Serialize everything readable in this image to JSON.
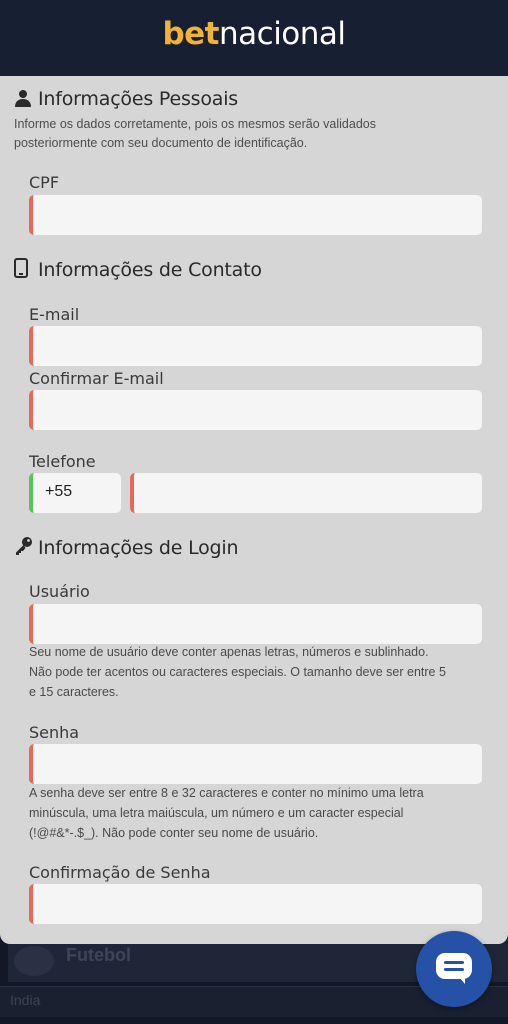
{
  "header": {
    "logo_bet": "bet",
    "logo_rest": "nacional"
  },
  "personal": {
    "title": "Informações Pessoais",
    "description_line1": "Informe os dados corretamente, pois os mesmos serão validados",
    "description_line2": "posteriormente com seu documento de identificação.",
    "cpf_label": "CPF",
    "cpf_value": ""
  },
  "contact": {
    "title": "Informações de Contato",
    "email_label": "E-mail",
    "email_value": "",
    "confirm_email_label": "Confirmar E-mail",
    "confirm_email_value": "",
    "phone_label": "Telefone",
    "country_code": "+55",
    "phone_value": ""
  },
  "login": {
    "title": "Informações de Login",
    "user_label": "Usuário",
    "user_value": "",
    "user_hint_line1": "Seu nome de usuário deve conter apenas letras, números e sublinhado.",
    "user_hint_line2": "Não pode ter acentos ou caracteres especiais. O tamanho deve ser entre 5",
    "user_hint_line3": "e 15 caracteres.",
    "password_label": "Senha",
    "password_value": "",
    "password_hint_line1": "A senha deve ser entre 8 e 32 caracteres e conter no mínimo uma letra",
    "password_hint_line2": "minúscula, uma letra maiúscula, um número e um caracter especial",
    "password_hint_line3": "(!@#&*-.$_). Não pode conter seu nome de usuário.",
    "confirm_password_label": "Confirmação de Senha",
    "confirm_password_value": ""
  },
  "background": {
    "sport_label": "Futebol",
    "country_label": "India"
  },
  "icons": {
    "person": "person-icon",
    "phone": "mobile-phone-icon",
    "key": "key-icon",
    "chat": "chat-bubble-icon",
    "ball": "soccer-ball-icon"
  },
  "colors": {
    "header_bg": "#172033",
    "brand_yellow": "#f1b333",
    "error_border": "#e5695a",
    "valid_border": "#58c35a",
    "chat_button": "#2552a6"
  }
}
